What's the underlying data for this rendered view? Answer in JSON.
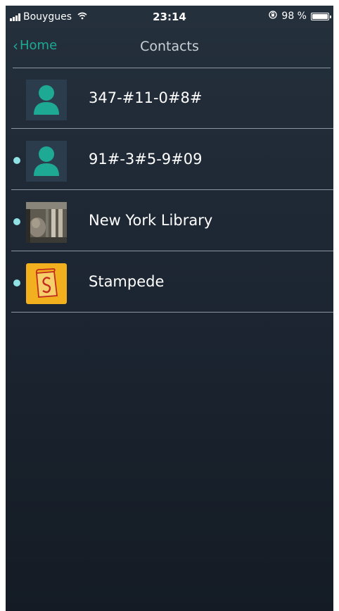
{
  "status_bar": {
    "carrier": "Bouygues",
    "time": "23:14",
    "battery_percent": "98 %"
  },
  "nav": {
    "back_label": "Home",
    "title": "Contacts"
  },
  "contacts": [
    {
      "name": "347-#11-0#8#",
      "avatar": "person-icon",
      "unread": false
    },
    {
      "name": "91#-3#5-9#09",
      "avatar": "person-icon",
      "unread": true
    },
    {
      "name": "New York Library",
      "avatar": "library-photo",
      "unread": true
    },
    {
      "name": "Stampede",
      "avatar": "stampede-logo",
      "unread": true
    }
  ],
  "colors": {
    "accent": "#1ea995",
    "unread_dot": "#8fe1e3",
    "background_top": "#24303c",
    "background_bottom": "#141b24",
    "divider": "#8d96a0"
  }
}
